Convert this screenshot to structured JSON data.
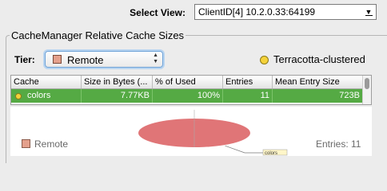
{
  "header": {
    "select_view_label": "Select View:",
    "select_view_value": "ClientID[4] 10.2.0.33:64199"
  },
  "group": {
    "title": "CacheManager Relative Cache Sizes"
  },
  "tier": {
    "label": "Tier:",
    "value": "Remote",
    "swatch_color": "#e4a08c"
  },
  "cluster": {
    "label": "Terracotta-clustered",
    "dot_color": "#f4d23a"
  },
  "table": {
    "columns": [
      "Cache",
      "Size in Bytes (...",
      "% of Used",
      "Entries",
      "Mean Entry Size"
    ],
    "rows": [
      {
        "cache": "colors",
        "size": "7.77KB",
        "percent": "100%",
        "entries": "11",
        "mean": "723B"
      }
    ],
    "row_highlight_color": "#55aa44"
  },
  "chart_data": {
    "type": "pie",
    "slices": [
      {
        "label": "colors",
        "value": 100
      }
    ],
    "color": "#e07577"
  },
  "legend": {
    "tier_label": "Remote",
    "entries_label": "Entries: 11"
  }
}
